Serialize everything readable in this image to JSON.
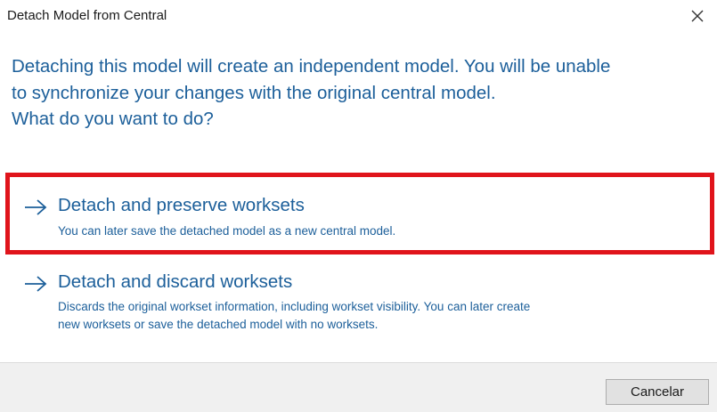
{
  "window": {
    "title": "Detach Model from Central",
    "close_icon": "close-icon"
  },
  "instruction": {
    "lines": [
      "Detaching this model will create an independent model. You will be unable",
      "to synchronize your changes with the original central model.",
      "What do you want to do?"
    ]
  },
  "options": [
    {
      "title": "Detach and preserve worksets",
      "description_lines": [
        "You can later save the detached model as a new central model."
      ],
      "icon": "arrow-right-icon",
      "highlighted": true
    },
    {
      "title": "Detach and discard worksets",
      "description_lines": [
        "Discards the original workset information, including workset visibility. You can later create",
        "new worksets or save the detached model with no worksets."
      ],
      "icon": "arrow-right-icon",
      "highlighted": false
    }
  ],
  "footer": {
    "cancel_label": "Cancelar"
  },
  "colors": {
    "link_text": "#1c5f9a",
    "highlight_border": "#e0141b",
    "footer_bg": "#f0f0f0"
  }
}
